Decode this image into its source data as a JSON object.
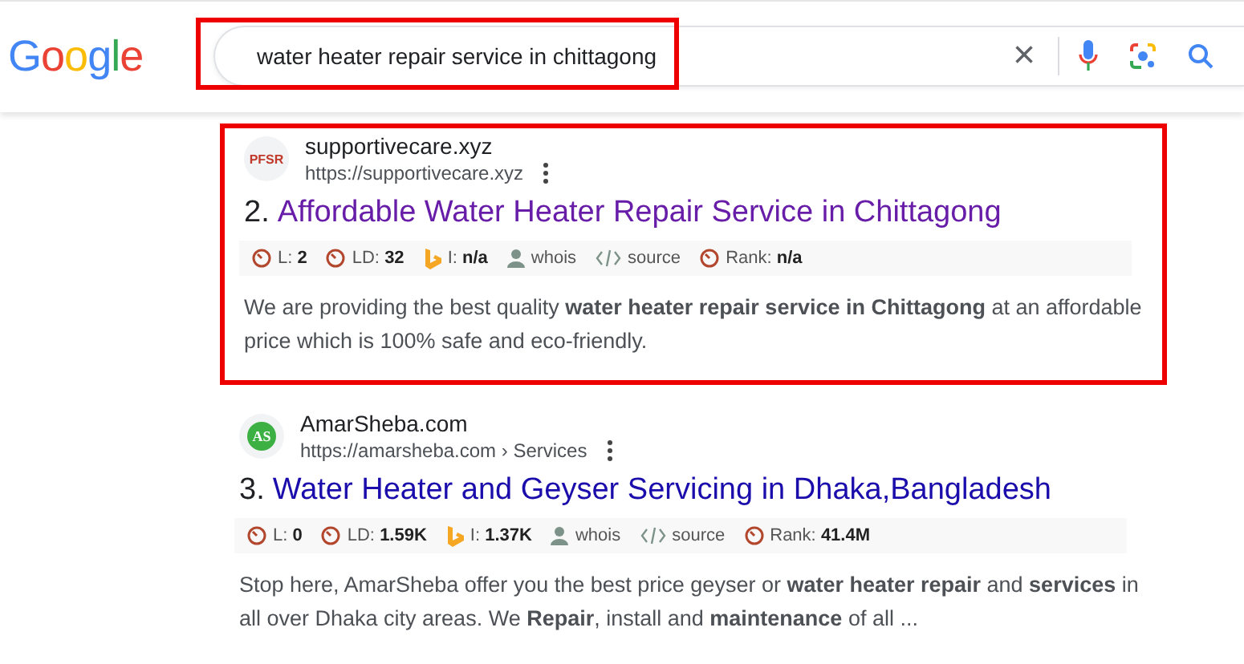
{
  "header": {
    "logo": "Google",
    "search": {
      "value": "water heater repair service in chittagong",
      "highlighted": true
    },
    "clear_icon": "×"
  },
  "results": [
    {
      "highlighted": true,
      "visited": true,
      "favicon": {
        "kind": "letters",
        "text": "PFSR"
      },
      "site_name": "supportivecare.xyz",
      "url": "https://supportivecare.xyz",
      "number": "2.",
      "title": "Affordable Water Heater Repair Service in Chittagong",
      "metrics": [
        {
          "kind": "moz",
          "label": "L:",
          "value": "2"
        },
        {
          "kind": "moz",
          "label": "LD:",
          "value": "32"
        },
        {
          "kind": "bing",
          "label": "I:",
          "value": "n/a"
        },
        {
          "kind": "whois",
          "label": "whois"
        },
        {
          "kind": "source",
          "label": "source"
        },
        {
          "kind": "moz",
          "label": "Rank:",
          "value": "n/a"
        }
      ],
      "snippet": "We are providing the best quality **water heater repair service in Chittagong** at an affordable price which is 100% safe and eco-friendly."
    },
    {
      "highlighted": false,
      "visited": false,
      "favicon": {
        "kind": "badge",
        "text": "AS"
      },
      "site_name": "AmarSheba.com",
      "url": "https://amarsheba.com › Services",
      "number": "3.",
      "title": "Water Heater and Geyser Servicing in Dhaka,Bangladesh",
      "metrics": [
        {
          "kind": "moz",
          "label": "L:",
          "value": "0"
        },
        {
          "kind": "moz",
          "label": "LD:",
          "value": "1.59K"
        },
        {
          "kind": "bing",
          "label": "I:",
          "value": "1.37K"
        },
        {
          "kind": "whois",
          "label": "whois"
        },
        {
          "kind": "source",
          "label": "source"
        },
        {
          "kind": "moz",
          "label": "Rank:",
          "value": "41.4M"
        }
      ],
      "snippet": "Stop here, AmarSheba offer you the best price geyser or **water heater repair** and **services** in all over Dhaka city areas. We **Repair**, install and **maintenance** of all ..."
    }
  ]
}
